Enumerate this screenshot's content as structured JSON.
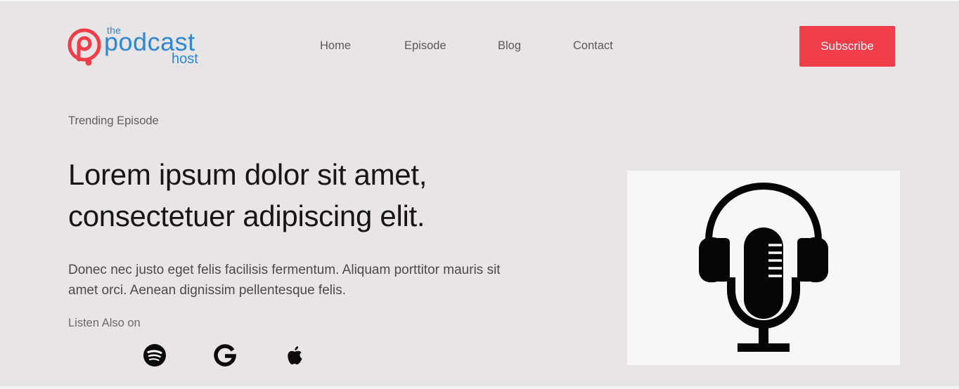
{
  "logo": {
    "the": "the",
    "podcast": "podcast",
    "host": "host",
    "accent_color": "#f03d4a",
    "text_color": "#2e86d4"
  },
  "nav": {
    "items": [
      {
        "label": "Home"
      },
      {
        "label": "Episode"
      },
      {
        "label": "Blog"
      },
      {
        "label": "Contact"
      }
    ]
  },
  "header": {
    "subscribe_label": "Subscribe",
    "subscribe_color": "#f03d4a"
  },
  "hero": {
    "eyebrow": "Trending Episode",
    "headline": "Lorem ipsum dolor sit amet, consectetuer adipiscing elit.",
    "description": "Donec nec justo eget felis facilisis fermentum. Aliquam porttitor mauris sit amet orci. Aenean dignissim pellentesque felis.",
    "listen_label": "Listen Also on",
    "platforms": [
      {
        "icon": "spotify-icon"
      },
      {
        "icon": "google-icon"
      },
      {
        "icon": "apple-icon"
      }
    ],
    "image_icon": "podcast-microphone-headphones-icon"
  }
}
